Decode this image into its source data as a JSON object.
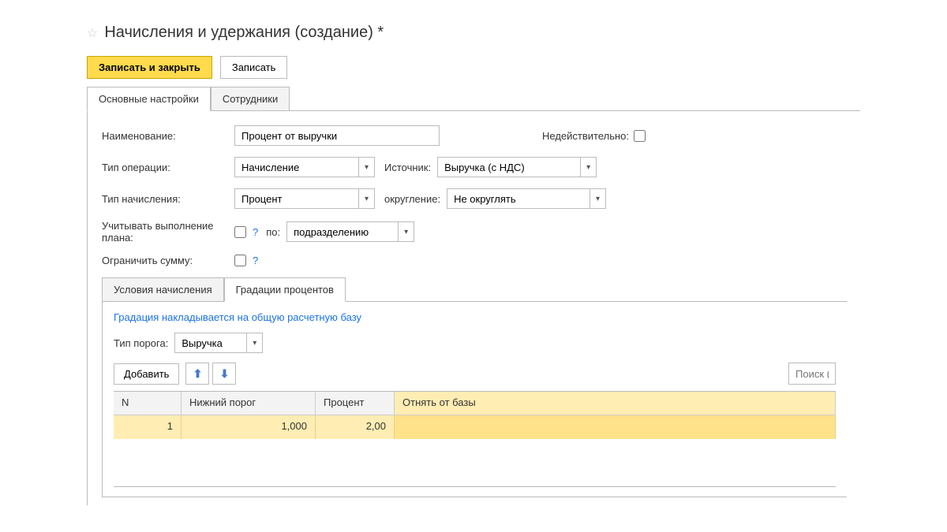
{
  "header": {
    "title": "Начисления и удержания (создание) *"
  },
  "toolbar": {
    "save_close_label": "Записать и закрыть",
    "save_label": "Записать"
  },
  "main_tabs": {
    "tab1": "Основные настройки",
    "tab2": "Сотрудники"
  },
  "form": {
    "name_label": "Наименование:",
    "name_value": "Процент от выручки",
    "invalid_label": "Недействительно:",
    "op_type_label": "Тип операции:",
    "op_type_value": "Начисление",
    "source_label": "Источник:",
    "source_value": "Выручка (с НДС)",
    "accrual_type_label": "Тип начисления:",
    "accrual_type_value": "Процент",
    "rounding_label": "округление:",
    "rounding_value": "Не округлять",
    "plan_label": "Учитывать выполнение плана:",
    "by_label": "по:",
    "by_value": "подразделению",
    "limit_label": "Ограничить сумму:",
    "help_mark": "?"
  },
  "sub_tabs": {
    "tab1": "Условия начисления",
    "tab2": "Градации процентов"
  },
  "gradation": {
    "info_text": "Градация накладывается на общую расчетную базу",
    "threshold_label": "Тип порога:",
    "threshold_value": "Выручка",
    "add_label": "Добавить",
    "search_placeholder": "Поиск (C"
  },
  "grid": {
    "headers": {
      "n": "N",
      "threshold": "Нижний порог",
      "percent": "Процент",
      "subtract": "Отнять от базы"
    },
    "rows": [
      {
        "n": "1",
        "threshold": "1,000",
        "percent": "2,00",
        "subtract": ""
      }
    ]
  }
}
